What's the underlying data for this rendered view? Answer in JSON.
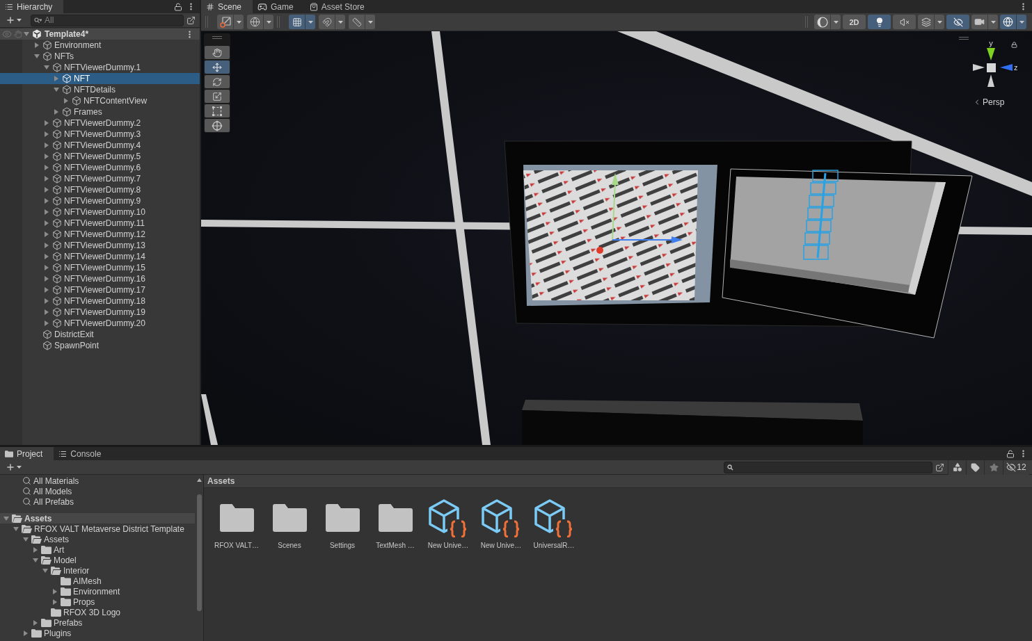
{
  "hierarchy": {
    "tab": {
      "label": "Hierarchy",
      "selected": true
    },
    "search": {
      "placeholder": "All"
    },
    "scene": {
      "name": "Template4*",
      "expanded": true
    },
    "items": [
      {
        "name": "Environment",
        "expanded": false,
        "selected": false
      },
      {
        "name": "NFTs",
        "expanded": true,
        "selected": false,
        "children": [
          {
            "name": "NFTViewerDummy.1",
            "expanded": true,
            "selected": false,
            "children": [
              {
                "name": "NFT",
                "expanded": false,
                "selected": true
              },
              {
                "name": "NFTDetails",
                "expanded": true,
                "selected": false,
                "children": [
                  {
                    "name": "NFTContentView",
                    "expanded": false,
                    "selected": false
                  }
                ]
              },
              {
                "name": "Frames",
                "expanded": false,
                "selected": false
              }
            ]
          },
          {
            "name": "NFTViewerDummy.2",
            "expanded": false,
            "selected": false
          },
          {
            "name": "NFTViewerDummy.3",
            "expanded": false,
            "selected": false
          },
          {
            "name": "NFTViewerDummy.4",
            "expanded": false,
            "selected": false
          },
          {
            "name": "NFTViewerDummy.5",
            "expanded": false,
            "selected": false
          },
          {
            "name": "NFTViewerDummy.6",
            "expanded": false,
            "selected": false
          },
          {
            "name": "NFTViewerDummy.7",
            "expanded": false,
            "selected": false
          },
          {
            "name": "NFTViewerDummy.8",
            "expanded": false,
            "selected": false
          },
          {
            "name": "NFTViewerDummy.9",
            "expanded": false,
            "selected": false
          },
          {
            "name": "NFTViewerDummy.10",
            "expanded": false,
            "selected": false
          },
          {
            "name": "NFTViewerDummy.11",
            "expanded": false,
            "selected": false
          },
          {
            "name": "NFTViewerDummy.12",
            "expanded": false,
            "selected": false
          },
          {
            "name": "NFTViewerDummy.13",
            "expanded": false,
            "selected": false
          },
          {
            "name": "NFTViewerDummy.14",
            "expanded": false,
            "selected": false
          },
          {
            "name": "NFTViewerDummy.15",
            "expanded": false,
            "selected": false
          },
          {
            "name": "NFTViewerDummy.16",
            "expanded": false,
            "selected": false
          },
          {
            "name": "NFTViewerDummy.17",
            "expanded": false,
            "selected": false
          },
          {
            "name": "NFTViewerDummy.18",
            "expanded": false,
            "selected": false
          },
          {
            "name": "NFTViewerDummy.19",
            "expanded": false,
            "selected": false
          },
          {
            "name": "NFTViewerDummy.20",
            "expanded": false,
            "selected": false
          }
        ]
      },
      {
        "name": "DistrictExit",
        "selected": false
      },
      {
        "name": "SpawnPoint",
        "selected": false
      }
    ]
  },
  "scene_view": {
    "tabs": [
      {
        "label": "Scene",
        "selected": true,
        "kind": "scene"
      },
      {
        "label": "Game",
        "selected": false,
        "kind": "game"
      },
      {
        "label": "Asset Store",
        "selected": false,
        "kind": "store"
      }
    ],
    "toolbar_left": [
      {
        "items": [
          {
            "kind": "handle",
            "selected": false,
            "dropdown": true
          },
          {
            "kind": "pivot",
            "selected": false,
            "dropdown": true
          }
        ]
      },
      {
        "items": [
          {
            "kind": "gridsnap",
            "selected": true,
            "dropdown": true
          },
          {
            "kind": "snap",
            "selected": false,
            "dropdown": true
          },
          {
            "kind": "ruler",
            "selected": false,
            "dropdown": true
          }
        ]
      }
    ],
    "toolbar_right": [
      {
        "items": [
          {
            "kind": "shading",
            "selected": false,
            "dropdown": true
          },
          {
            "kind": "dimension",
            "label": "2D",
            "selected": false,
            "dropdown": false
          },
          {
            "kind": "lighting",
            "selected": true,
            "dropdown": false
          },
          {
            "kind": "audio",
            "selected": false,
            "dropdown": false
          },
          {
            "kind": "effects",
            "selected": false,
            "dropdown": true
          },
          {
            "kind": "visibility",
            "selected": true,
            "dropdown": false
          },
          {
            "kind": "camera",
            "selected": false,
            "dropdown": true
          },
          {
            "kind": "gizmos",
            "selected": true,
            "dropdown": true
          }
        ]
      }
    ],
    "tools": [
      {
        "kind": "hand",
        "selected": false
      },
      {
        "kind": "move",
        "selected": true
      },
      {
        "kind": "rotate",
        "selected": false
      },
      {
        "kind": "scale",
        "selected": false
      },
      {
        "kind": "rect",
        "selected": false
      },
      {
        "kind": "transform",
        "selected": false
      }
    ],
    "gizmo": {
      "axis_labels": [
        "y",
        "z"
      ],
      "projection": "Persp"
    }
  },
  "project": {
    "tabs": [
      {
        "label": "Project",
        "selected": true,
        "kind": "project"
      },
      {
        "label": "Console",
        "selected": false,
        "kind": "console"
      }
    ],
    "hidden_count": "12",
    "favorites": [
      "All Materials",
      "All Models",
      "All Prefabs"
    ],
    "tree": [
      {
        "name": "Assets",
        "expanded": true,
        "selected": true,
        "children": [
          {
            "name": "RFOX VALT Metaverse District Template",
            "expanded": true,
            "selected": false,
            "children": [
              {
                "name": "Assets",
                "expanded": true,
                "selected": false,
                "children": [
                  {
                    "name": "Art",
                    "expanded": false,
                    "selected": false
                  },
                  {
                    "name": "Model",
                    "expanded": true,
                    "selected": false,
                    "children": [
                      {
                        "name": "Interior",
                        "expanded": true,
                        "selected": false,
                        "children": [
                          {
                            "name": "AIMesh",
                            "selected": false
                          },
                          {
                            "name": "Environment",
                            "expanded": false,
                            "selected": false
                          },
                          {
                            "name": "Props",
                            "expanded": false,
                            "selected": false
                          }
                        ]
                      },
                      {
                        "name": "RFOX 3D Logo",
                        "selected": false
                      }
                    ]
                  },
                  {
                    "name": "Prefabs",
                    "expanded": false,
                    "selected": false
                  }
                ]
              },
              {
                "name": "Plugins",
                "expanded": false,
                "selected": false
              }
            ]
          }
        ]
      }
    ],
    "breadcrumb": "Assets",
    "assets": [
      {
        "name": "RFOX VALT…",
        "kind": "folder"
      },
      {
        "name": "Scenes",
        "kind": "folder"
      },
      {
        "name": "Settings",
        "kind": "folder"
      },
      {
        "name": "TextMesh …",
        "kind": "folder"
      },
      {
        "name": "New Unive…",
        "kind": "asset"
      },
      {
        "name": "New Unive…",
        "kind": "asset"
      },
      {
        "name": "UniversalR…",
        "kind": "asset"
      }
    ]
  }
}
